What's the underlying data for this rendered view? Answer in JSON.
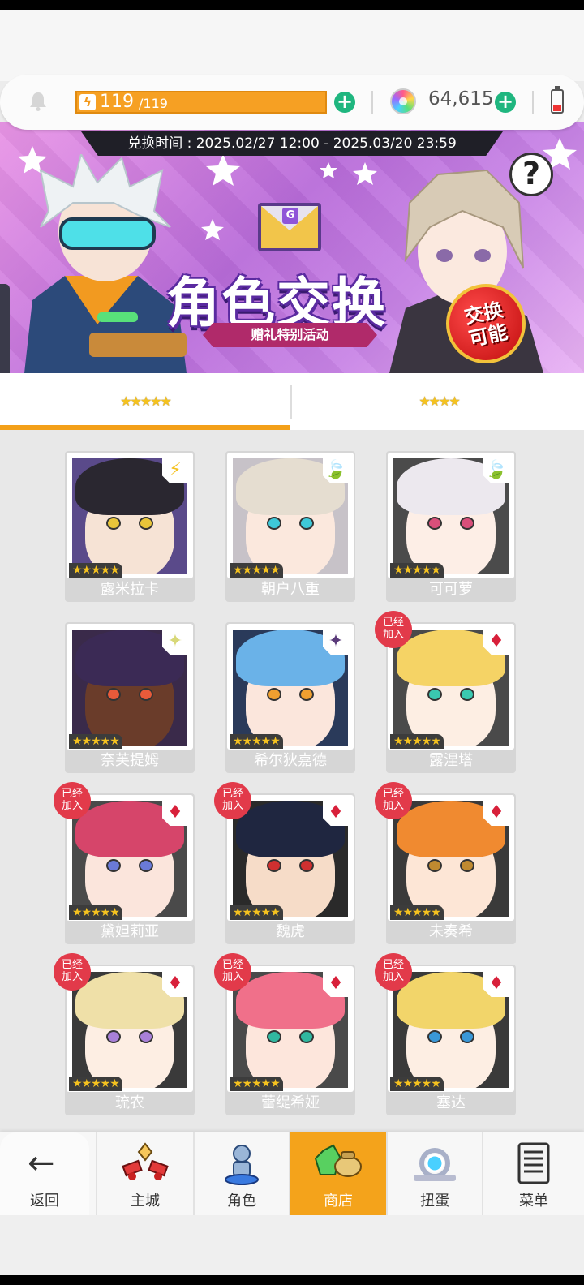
{
  "resources": {
    "energy_current": "119",
    "energy_max": "/119",
    "energy_fill": 1.0,
    "gems": "64,615"
  },
  "banner": {
    "exchange_time": "兑换时间 : 2025.02/27 12:00 - 2025.03/20 23:59",
    "title": "角色交换",
    "subtitle": "赠礼特别活动",
    "badge": "交换可能",
    "help": "?",
    "envelope_seal": "G"
  },
  "tabs": [
    {
      "label": "★★★★★",
      "stars": 5,
      "active": true
    },
    {
      "label": "★★★★",
      "stars": 4,
      "active": false
    }
  ],
  "characters": [
    {
      "name": "露米拉卡",
      "stars": "★★★★★",
      "attribute": "lightning-icon",
      "attr_glyph": "⚡",
      "joined": false,
      "hair": "#2a2730",
      "skin": "#f6e3d5",
      "bg": "#5a4a8a",
      "eye": "#e8c53a"
    },
    {
      "name": "朝户八重",
      "stars": "★★★★★",
      "attribute": "leaf-icon",
      "attr_glyph": "🍃",
      "joined": false,
      "hair": "#e5ddd0",
      "skin": "#fbe8dd",
      "bg": "#c7c2c8",
      "eye": "#3ec8d8"
    },
    {
      "name": "可可萝",
      "stars": "★★★★★",
      "attribute": "leaf-icon",
      "attr_glyph": "🍃",
      "joined": false,
      "hair": "#ece8ee",
      "skin": "#fdeee6",
      "bg": "#4b4b4b",
      "eye": "#d84f7a"
    },
    {
      "name": "奈芙提姆",
      "stars": "★★★★★",
      "attribute": "light-icon",
      "attr_glyph": "✦",
      "joined": false,
      "hair": "#3b2a55",
      "skin": "#6a3c2a",
      "bg": "#3a2a4a",
      "eye": "#e85a3a"
    },
    {
      "name": "希尔狄嘉德",
      "stars": "★★★★★",
      "attribute": "dark-icon",
      "attr_glyph": "✦",
      "joined": false,
      "hair": "#6ab2e8",
      "skin": "#fbe6dc",
      "bg": "#2a3a5a",
      "eye": "#f0a030"
    },
    {
      "name": "露涅塔",
      "stars": "★★★★★",
      "attribute": "diamond-icon",
      "attr_glyph": "♦",
      "joined": true,
      "hair": "#f5d365",
      "skin": "#fdeee3",
      "bg": "#4a4a4a",
      "eye": "#3ac8b0"
    },
    {
      "name": "黛妲莉亚",
      "stars": "★★★★★",
      "attribute": "diamond-icon",
      "attr_glyph": "♦",
      "joined": true,
      "hair": "#d6456a",
      "skin": "#fbe5dc",
      "bg": "#4a4a4a",
      "eye": "#6a7ad8"
    },
    {
      "name": "魏虎",
      "stars": "★★★★★",
      "attribute": "diamond-icon",
      "attr_glyph": "♦",
      "joined": true,
      "hair": "#1f2640",
      "skin": "#f6dcc8",
      "bg": "#2a2a2a",
      "eye": "#d03030"
    },
    {
      "name": "未奏希",
      "stars": "★★★★★",
      "attribute": "diamond-icon",
      "attr_glyph": "♦",
      "joined": true,
      "hair": "#f08a30",
      "skin": "#fde6d6",
      "bg": "#3a3a3a",
      "eye": "#c08a30"
    },
    {
      "name": "琉农",
      "stars": "★★★★★",
      "attribute": "diamond-icon",
      "attr_glyph": "♦",
      "joined": true,
      "hair": "#efe0a8",
      "skin": "#fdeee3",
      "bg": "#3a3a3a",
      "eye": "#a880d8"
    },
    {
      "name": "蕾缇希娅",
      "stars": "★★★★★",
      "attribute": "diamond-icon",
      "attr_glyph": "♦",
      "joined": true,
      "hair": "#f0708a",
      "skin": "#fde6dc",
      "bg": "#4a4a4a",
      "eye": "#30b8a0"
    },
    {
      "name": "塞达",
      "stars": "★★★★★",
      "attribute": "diamond-icon",
      "attr_glyph": "♦",
      "joined": true,
      "hair": "#f2d56a",
      "skin": "#fdeee3",
      "bg": "#3a3a3a",
      "eye": "#3a98d8"
    }
  ],
  "joined_label_line1": "已经",
  "joined_label_line2": "加入",
  "nav": {
    "back": "返回",
    "city": "主城",
    "character": "角色",
    "shop": "商店",
    "gacha": "扭蛋",
    "menu": "菜单"
  },
  "colors": {
    "accent": "#f4a31b",
    "energy": "#f6a023",
    "plus": "#1fb67f",
    "joined_badge": "#e23a4a",
    "diamond_attr": "#d8203a"
  }
}
